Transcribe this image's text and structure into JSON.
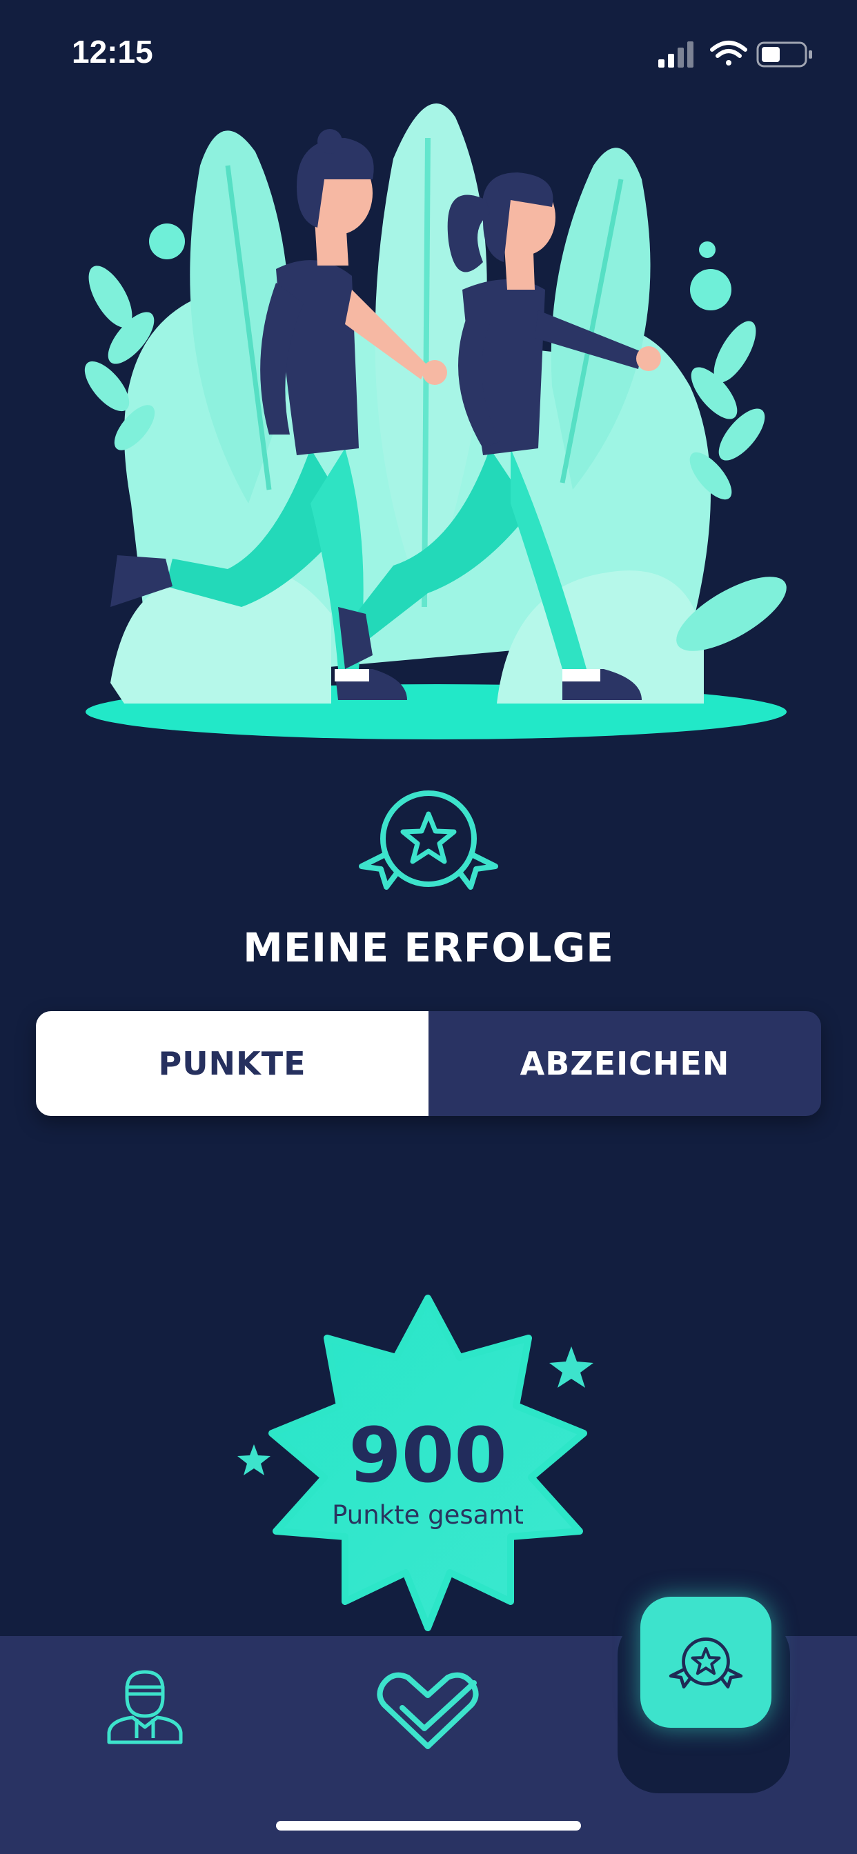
{
  "status_bar": {
    "time": "12:15",
    "icons": [
      "cellular-signal-icon",
      "wifi-icon",
      "battery-icon"
    ]
  },
  "illustration": {
    "subject": "two-runners-jogging-illustration"
  },
  "header": {
    "icon": "award-ribbon-icon",
    "title": "MEINE ERFOLGE"
  },
  "segmented_control": {
    "tabs": [
      {
        "label": "PUNKTE",
        "selected": true
      },
      {
        "label": "ABZEICHEN",
        "selected": false
      }
    ]
  },
  "points_badge": {
    "value": "900",
    "label": "Punkte gesamt"
  },
  "bottom_nav": {
    "items": [
      {
        "icon": "profile-icon",
        "active": false
      },
      {
        "icon": "heart-check-icon",
        "active": false
      },
      {
        "icon": "award-icon",
        "active": true
      }
    ]
  },
  "colors": {
    "background": "#121e3f",
    "accent": "#3de3cc",
    "navy": "#293363",
    "white": "#ffffff"
  }
}
